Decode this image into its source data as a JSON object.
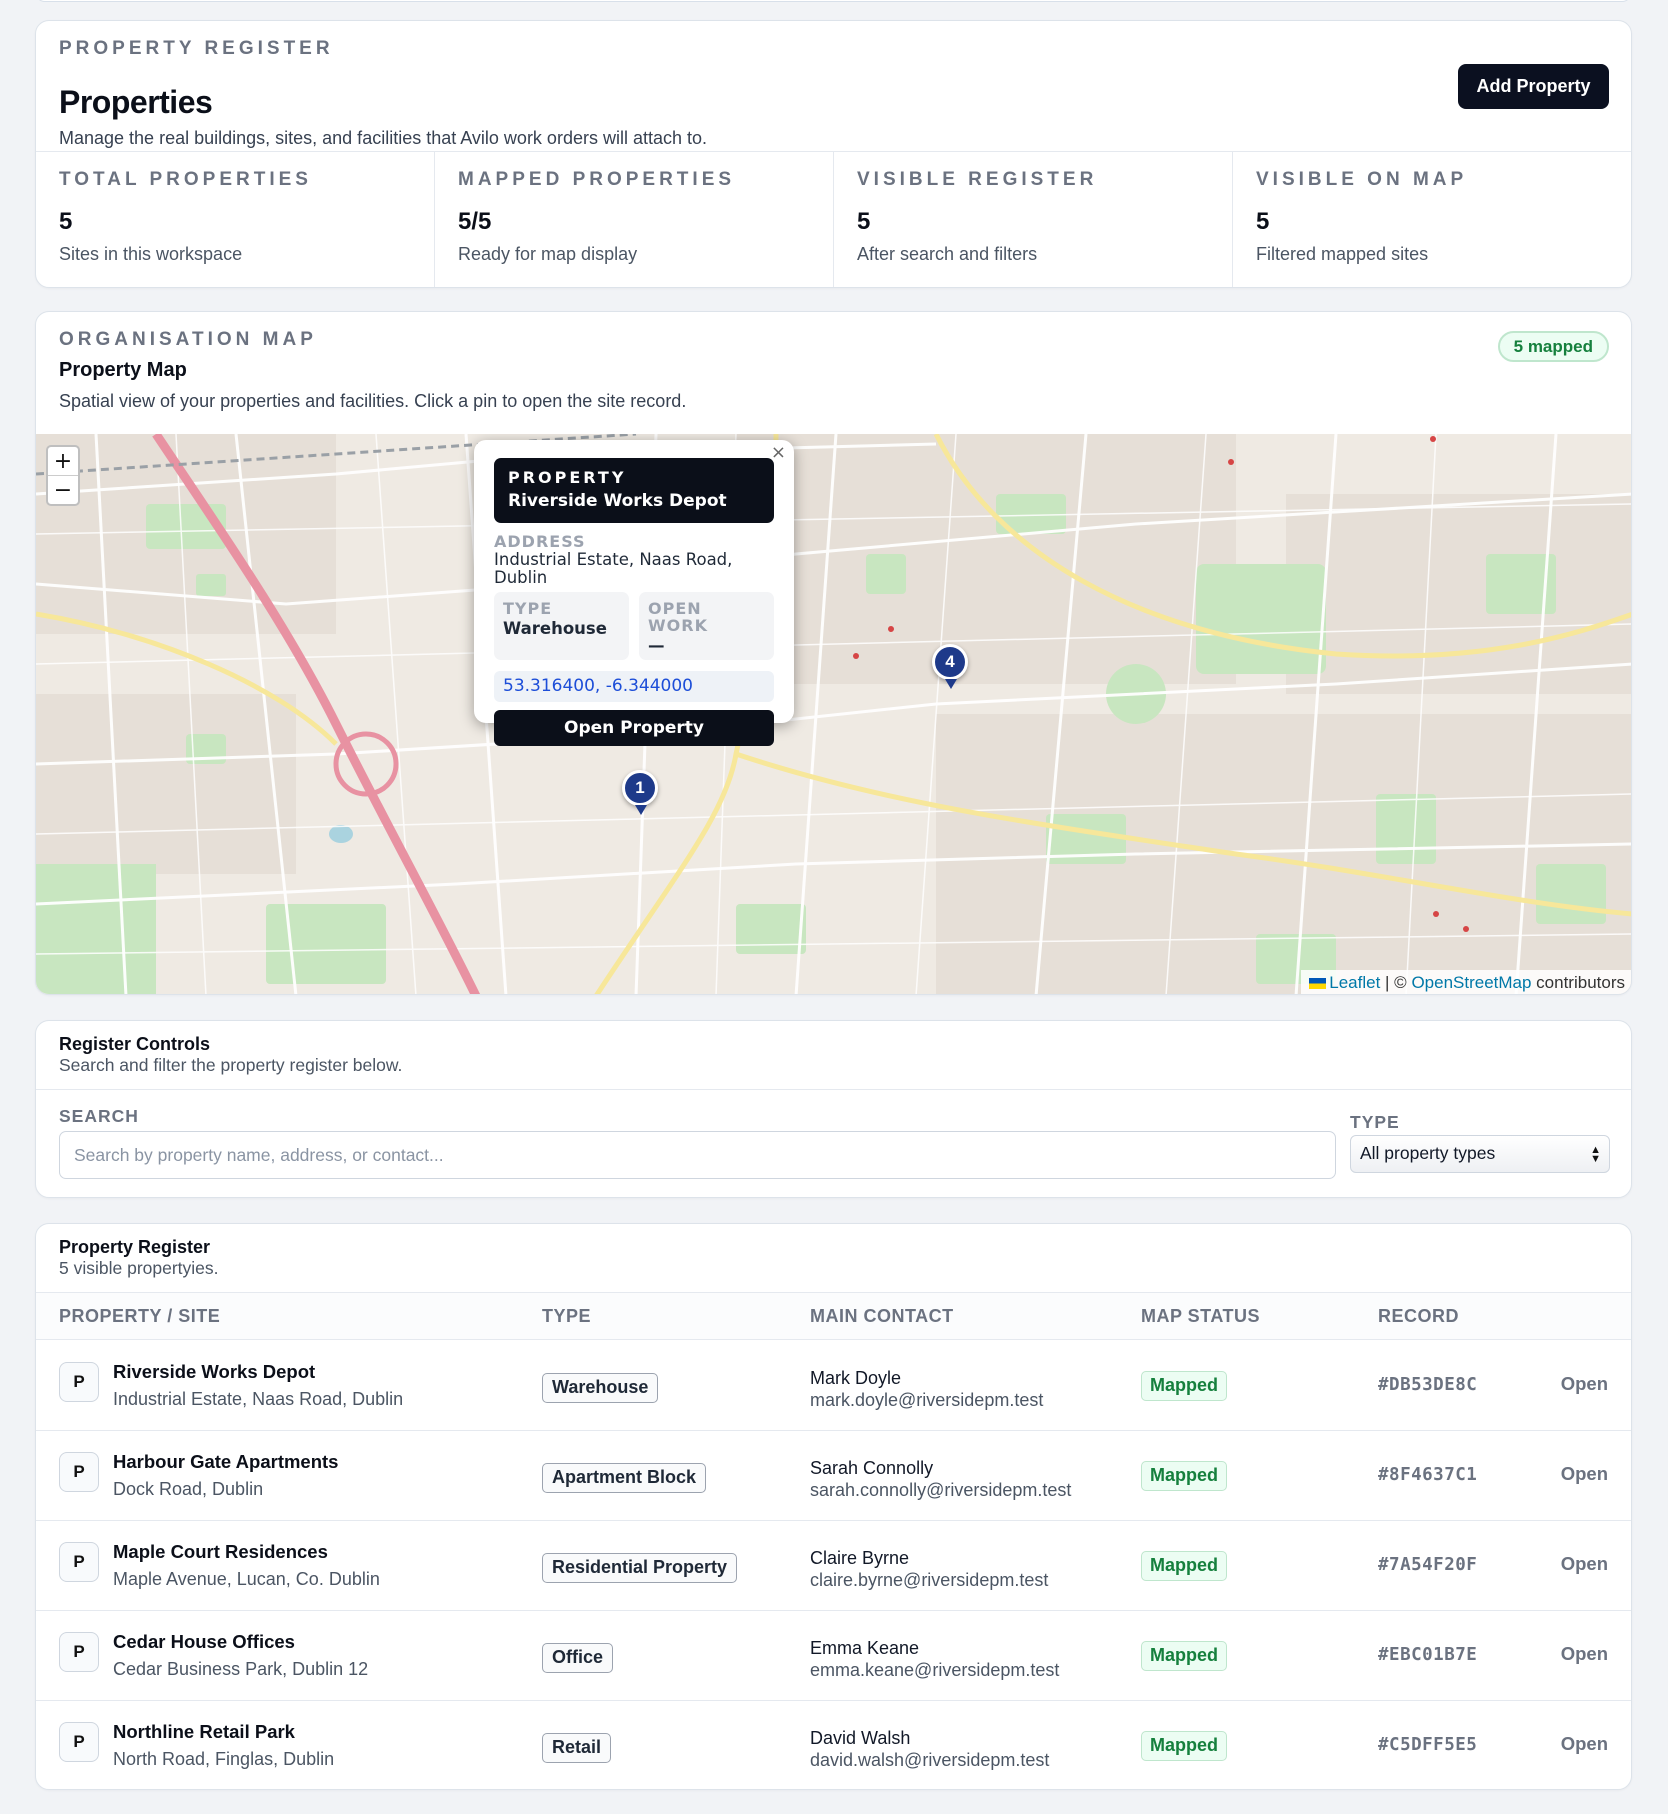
{
  "header": {
    "eyebrow": "PROPERTY REGISTER",
    "title": "Properties",
    "description": "Manage the real buildings, sites, and facilities that Avilo work orders will attach to.",
    "add_button": "Add Property"
  },
  "stats": [
    {
      "label": "TOTAL PROPERTIES",
      "value": "5",
      "sub": "Sites in this workspace"
    },
    {
      "label": "MAPPED PROPERTIES",
      "value": "5/5",
      "sub": "Ready for map display"
    },
    {
      "label": "VISIBLE REGISTER",
      "value": "5",
      "sub": "After search and filters"
    },
    {
      "label": "VISIBLE ON MAP",
      "value": "5",
      "sub": "Filtered mapped sites"
    }
  ],
  "map_section": {
    "eyebrow": "ORGANISATION MAP",
    "title": "Property Map",
    "description": "Spatial view of your properties and facilities. Click a pin to open the site record.",
    "badge": "5 mapped",
    "zoom_in": "+",
    "zoom_out": "−",
    "pins": [
      "1",
      "4"
    ],
    "attribution": {
      "leaflet": "Leaflet",
      "sep": " | © ",
      "osm": "OpenStreetMap",
      "suffix": " contributors"
    },
    "popup": {
      "close": "×",
      "heading_label": "PROPERTY",
      "heading_value": "Riverside Works Depot",
      "address_label": "ADDRESS",
      "address_value": "Industrial Estate, Naas Road, Dublin",
      "type_label": "TYPE",
      "type_value": "Warehouse",
      "open_work_label": "OPEN WORK",
      "open_work_value": "—",
      "coordinates": "53.316400, -6.344000",
      "button": "Open Property"
    }
  },
  "controls": {
    "title": "Register Controls",
    "subtitle": "Search and filter the property register below.",
    "search_label": "SEARCH",
    "search_placeholder": "Search by property name, address, or contact...",
    "search_value": "",
    "type_label": "TYPE",
    "type_selected": "All property types"
  },
  "register": {
    "title": "Property Register",
    "subtitle": "5 visible propertyies.",
    "columns": [
      "PROPERTY / SITE",
      "TYPE",
      "MAIN CONTACT",
      "MAP STATUS",
      "RECORD"
    ],
    "rows": [
      {
        "avatar": "P",
        "name": "Riverside Works Depot",
        "address": "Industrial Estate, Naas Road, Dublin",
        "type": "Warehouse",
        "contact": "Mark Doyle",
        "email": "mark.doyle@riversidepm.test",
        "status": "Mapped",
        "record": "#DB53DE8C",
        "action": "Open"
      },
      {
        "avatar": "P",
        "name": "Harbour Gate Apartments",
        "address": "Dock Road, Dublin",
        "type": "Apartment Block",
        "contact": "Sarah Connolly",
        "email": "sarah.connolly@riversidepm.test",
        "status": "Mapped",
        "record": "#8F4637C1",
        "action": "Open"
      },
      {
        "avatar": "P",
        "name": "Maple Court Residences",
        "address": "Maple Avenue, Lucan, Co. Dublin",
        "type": "Residential Property",
        "contact": "Claire Byrne",
        "email": "claire.byrne@riversidepm.test",
        "status": "Mapped",
        "record": "#7A54F20F",
        "action": "Open"
      },
      {
        "avatar": "P",
        "name": "Cedar House Offices",
        "address": "Cedar Business Park, Dublin 12",
        "type": "Office",
        "contact": "Emma Keane",
        "email": "emma.keane@riversidepm.test",
        "status": "Mapped",
        "record": "#EBC01B7E",
        "action": "Open"
      },
      {
        "avatar": "P",
        "name": "Northline Retail Park",
        "address": "North Road, Finglas, Dublin",
        "type": "Retail",
        "contact": "David Walsh",
        "email": "david.walsh@riversidepm.test",
        "status": "Mapped",
        "record": "#C5DFF5E5",
        "action": "Open"
      }
    ]
  },
  "colors": {
    "accent_dark": "#0b1020",
    "mapped_green": "#15803d",
    "pin_blue": "#1e3a8a"
  }
}
